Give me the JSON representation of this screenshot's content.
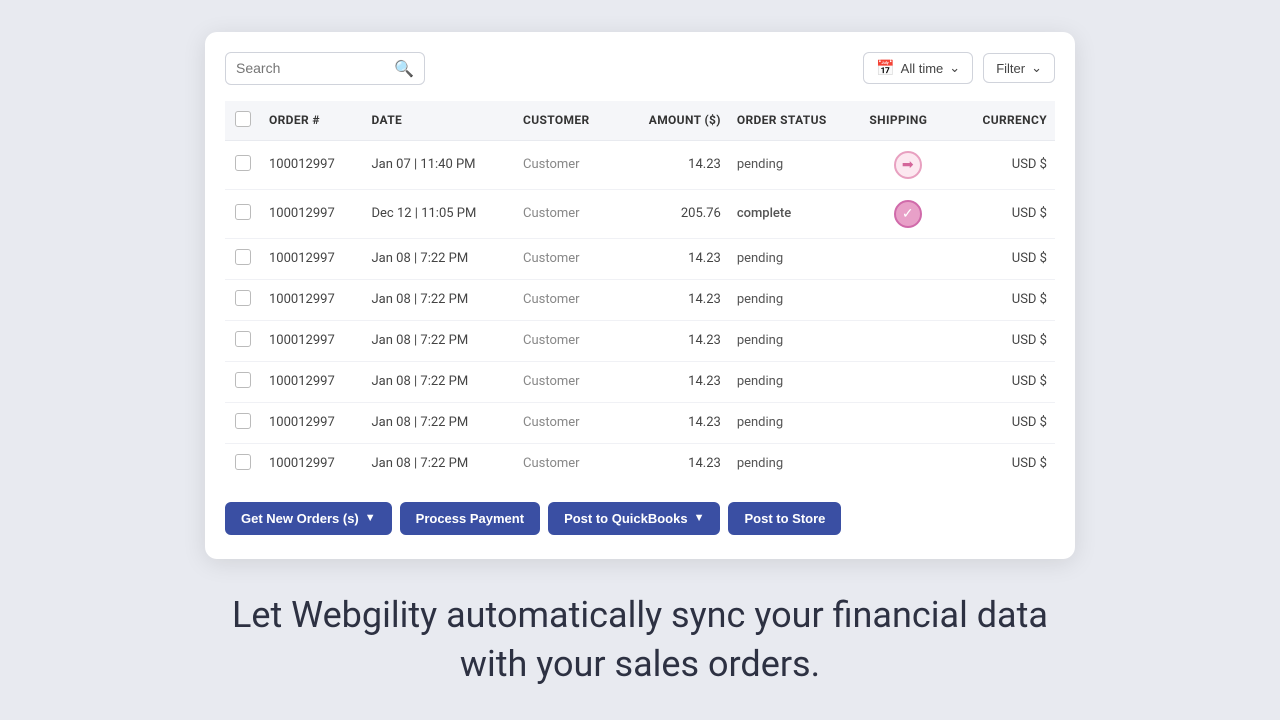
{
  "search": {
    "placeholder": "Search"
  },
  "filters": {
    "time_label": "All time",
    "filter_label": "Filter"
  },
  "table": {
    "columns": [
      {
        "id": "checkbox",
        "label": ""
      },
      {
        "id": "order",
        "label": "ORDER #"
      },
      {
        "id": "date",
        "label": "DATE"
      },
      {
        "id": "customer",
        "label": "CUSTOMER"
      },
      {
        "id": "amount",
        "label": "AMOUNT ($)"
      },
      {
        "id": "status",
        "label": "ORDER STATUS"
      },
      {
        "id": "shipping",
        "label": "SHIPPING"
      },
      {
        "id": "currency",
        "label": "CURRENCY"
      }
    ],
    "rows": [
      {
        "order": "100012997",
        "date": "Jan 07 | 11:40 PM",
        "customer": "Customer",
        "amount": "14.23",
        "status": "pending",
        "shipping": "arrow",
        "currency": "USD $"
      },
      {
        "order": "100012997",
        "date": "Dec 12 | 11:05 PM",
        "customer": "Customer",
        "amount": "205.76",
        "status": "complete",
        "shipping": "check",
        "currency": "USD $"
      },
      {
        "order": "100012997",
        "date": "Jan 08 | 7:22 PM",
        "customer": "Customer",
        "amount": "14.23",
        "status": "pending",
        "shipping": "",
        "currency": "USD $"
      },
      {
        "order": "100012997",
        "date": "Jan 08 | 7:22 PM",
        "customer": "Customer",
        "amount": "14.23",
        "status": "pending",
        "shipping": "",
        "currency": "USD $"
      },
      {
        "order": "100012997",
        "date": "Jan 08 | 7:22 PM",
        "customer": "Customer",
        "amount": "14.23",
        "status": "pending",
        "shipping": "",
        "currency": "USD $"
      },
      {
        "order": "100012997",
        "date": "Jan 08 | 7:22 PM",
        "customer": "Customer",
        "amount": "14.23",
        "status": "pending",
        "shipping": "",
        "currency": "USD $"
      },
      {
        "order": "100012997",
        "date": "Jan 08 | 7:22 PM",
        "customer": "Customer",
        "amount": "14.23",
        "status": "pending",
        "shipping": "",
        "currency": "USD $"
      },
      {
        "order": "100012997",
        "date": "Jan 08 | 7:22 PM",
        "customer": "Customer",
        "amount": "14.23",
        "status": "pending",
        "shipping": "",
        "currency": "USD $"
      }
    ]
  },
  "buttons": {
    "get_new_orders": "Get New Orders (s)",
    "process_payment": "Process Payment",
    "post_to_quickbooks": "Post to QuickBooks",
    "post_to_store": "Post to Store"
  },
  "tagline": "Let Webgility automatically sync your financial data with your sales orders."
}
